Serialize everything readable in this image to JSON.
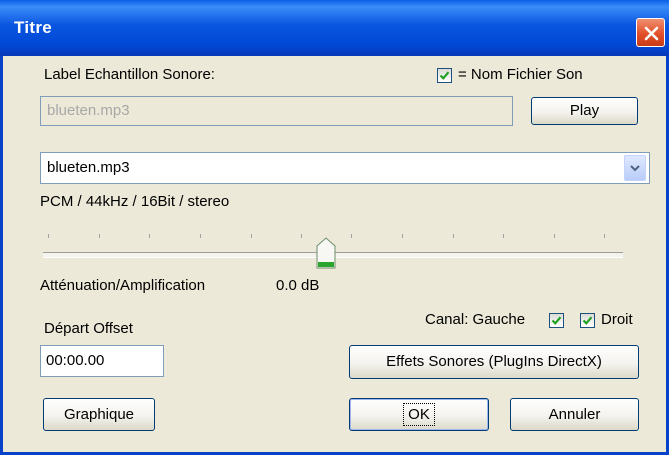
{
  "window": {
    "title": "Titre"
  },
  "sample_label": {
    "label": "Label Echantillon Sonore:",
    "value": "blueten.mp3",
    "same_as_file_label": "= Nom Fichier Son",
    "same_as_file_checked": true
  },
  "play_button": "Play",
  "file_combo": {
    "value": "blueten.mp3"
  },
  "format_text": "PCM / 44kHz / 16Bit / stereo",
  "slider": {
    "label": "Atténuation/Amplification",
    "value_text": "0.0 dB",
    "position": 0.5
  },
  "offset": {
    "label": "Départ Offset",
    "value": "00:00.00"
  },
  "channel": {
    "label": "Canal: Gauche",
    "left_checked": true,
    "right_label": "Droit",
    "right_checked": true
  },
  "effects_button": "Effets Sonores (PlugIns DirectX)",
  "buttons": {
    "graphic": "Graphique",
    "ok": "OK",
    "cancel": "Annuler"
  },
  "colors": {
    "title_bar": "#0a55e0",
    "checkmark": "#21a121",
    "close": "#e2502a"
  }
}
